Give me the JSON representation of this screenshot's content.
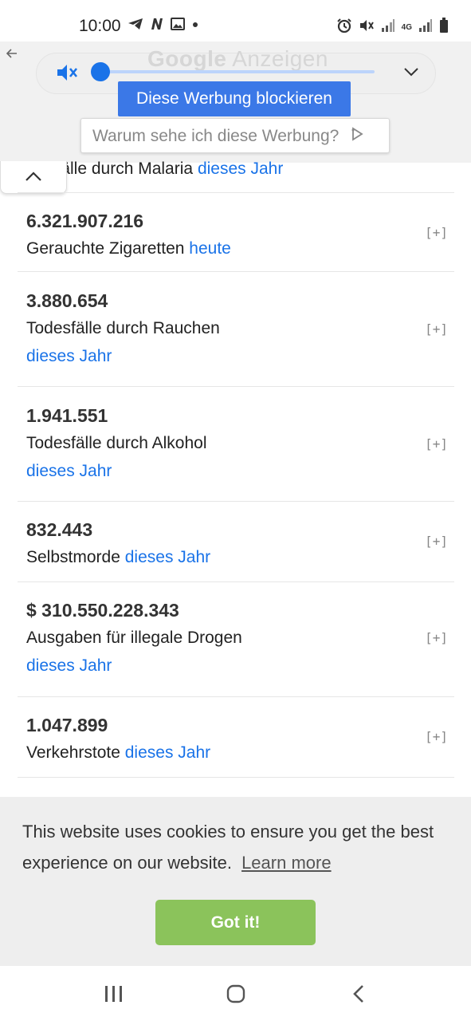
{
  "status_bar": {
    "time": "10:00",
    "network_label": "4G"
  },
  "ad": {
    "ghost_title_brand": "Google",
    "ghost_title_suffix": "Anzeigen",
    "block_label": "Diese Werbung blockieren",
    "why_label": "Warum sehe ich diese Werbung?",
    "slider_value": 0,
    "accent_color": "#1a73e8"
  },
  "partial_row": {
    "text": "sfälle durch Malaria",
    "period": "dieses Jahr"
  },
  "stats": [
    {
      "value": "6.321.907.216",
      "label": "Gerauchte Zigaretten",
      "period": "heute",
      "expand": "[+]"
    },
    {
      "value": "3.880.654",
      "label": "Todesfälle durch Rauchen",
      "period": "dieses Jahr",
      "expand": "[+]"
    },
    {
      "value": "1.941.551",
      "label": "Todesfälle durch Alkohol",
      "period": "dieses Jahr",
      "expand": "[+]"
    },
    {
      "value": "832.443",
      "label": "Selbstmorde",
      "period": "dieses Jahr",
      "expand": "[+]"
    },
    {
      "value": "$ 310.550.228.343",
      "label": "Ausgaben für illegale Drogen",
      "period": "dieses Jahr",
      "expand": "[+]"
    },
    {
      "value": "1.047.899",
      "label": "Verkehrstote",
      "period": "dieses Jahr",
      "expand": "[+]"
    }
  ],
  "cookie": {
    "message": "This website uses cookies to ensure you get the best experience on our website.",
    "learn_more": "Learn more",
    "button": "Got it!",
    "button_color": "#8bc35b"
  },
  "icons": {
    "status_left": [
      "telegram-icon",
      "n-app-icon",
      "gallery-icon",
      "dot-icon"
    ],
    "status_right": [
      "alarm-icon",
      "mute-icon",
      "signal-icon",
      "signal-icon",
      "battery-icon"
    ],
    "nav": [
      "recents-icon",
      "home-icon",
      "back-icon"
    ]
  }
}
